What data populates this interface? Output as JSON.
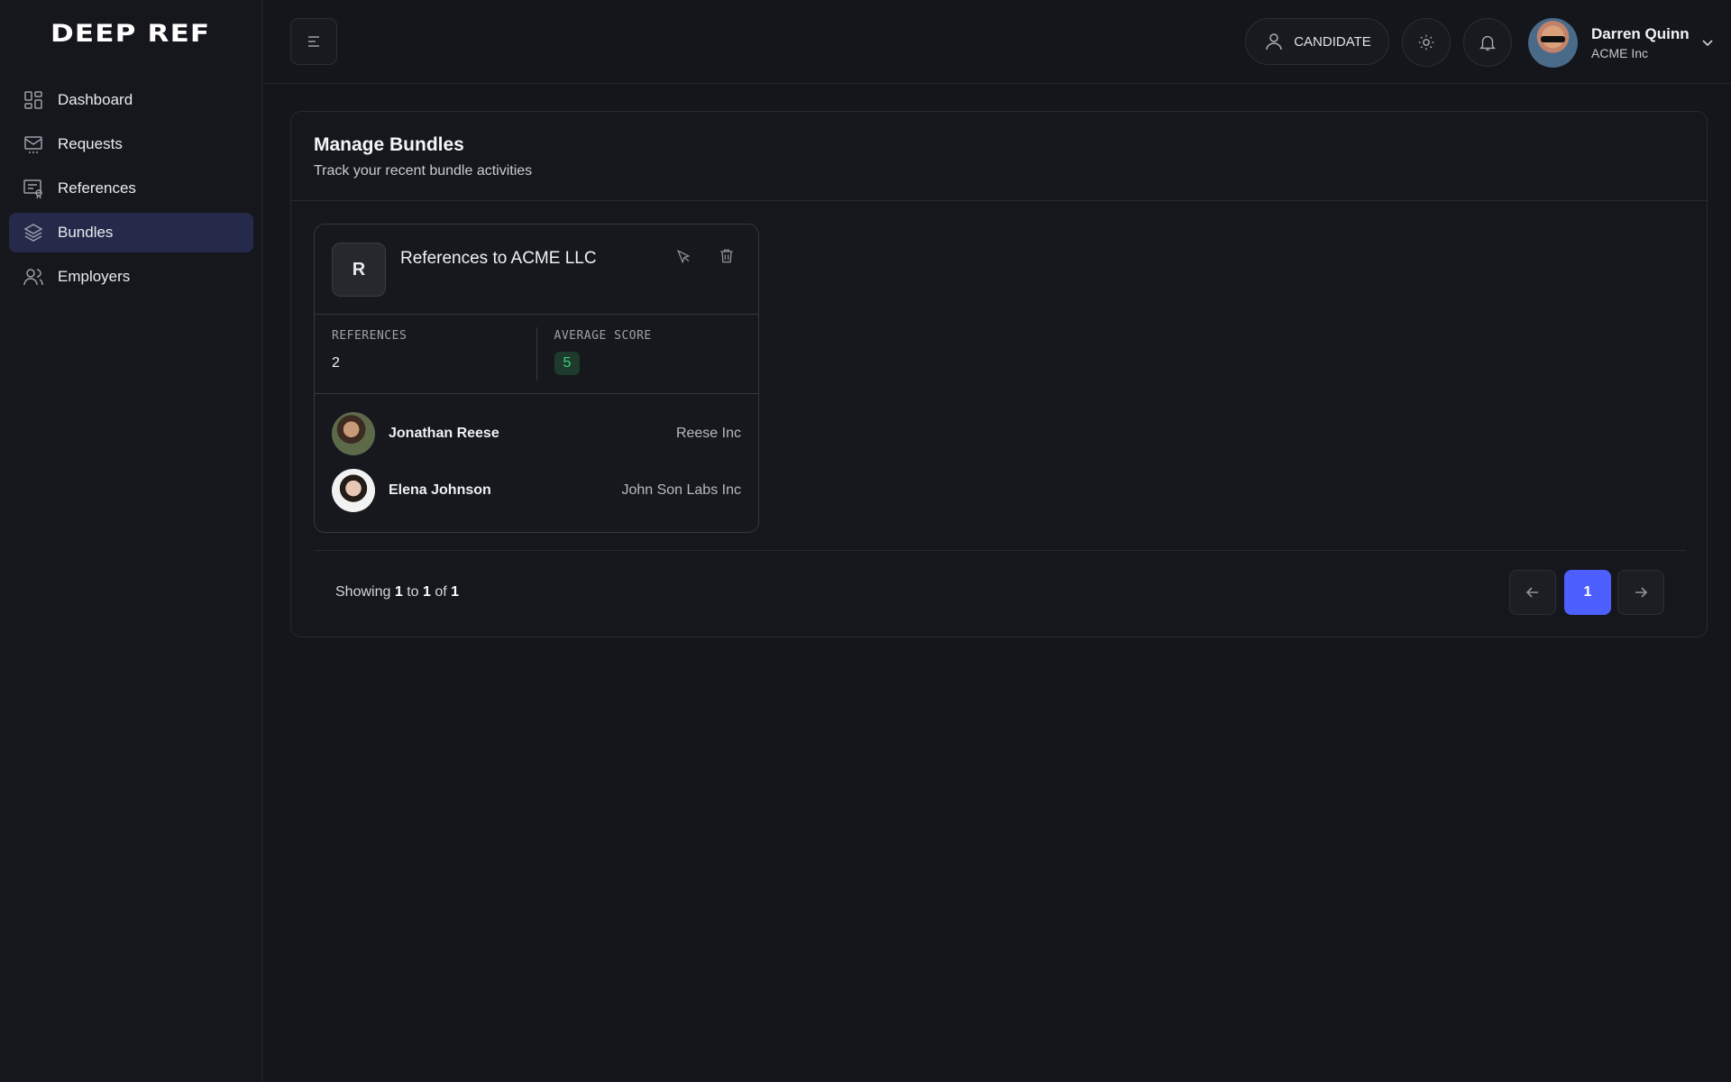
{
  "app": {
    "logo": "DEEP REF"
  },
  "sidebar": {
    "items": [
      {
        "label": "Dashboard",
        "icon": "dashboard-icon"
      },
      {
        "label": "Requests",
        "icon": "requests-icon"
      },
      {
        "label": "References",
        "icon": "references-icon"
      },
      {
        "label": "Bundles",
        "icon": "bundles-icon",
        "active": true
      },
      {
        "label": "Employers",
        "icon": "employers-icon"
      }
    ]
  },
  "header": {
    "role_label": "CANDIDATE",
    "user_name": "Darren Quinn",
    "user_org": "ACME Inc"
  },
  "main": {
    "title": "Manage Bundles",
    "subtitle": "Track your recent bundle activities",
    "bundle": {
      "badge": "R",
      "title": "References to ACME LLC",
      "references_label": "REFERENCES",
      "references_value": "2",
      "score_label": "AVERAGE SCORE",
      "score_value": "5",
      "refs": [
        {
          "name": "Jonathan Reese",
          "org": "Reese Inc"
        },
        {
          "name": "Elena Johnson",
          "org": "John Son Labs Inc"
        }
      ]
    },
    "pagination": {
      "showing_prefix": "Showing",
      "from": "1",
      "to_word": "to",
      "to": "1",
      "of_word": "of",
      "total": "1",
      "current_page": "1"
    }
  },
  "colors": {
    "accent": "#4d5fff",
    "active_nav": "#252a4a",
    "score_text": "#3fd27c"
  }
}
